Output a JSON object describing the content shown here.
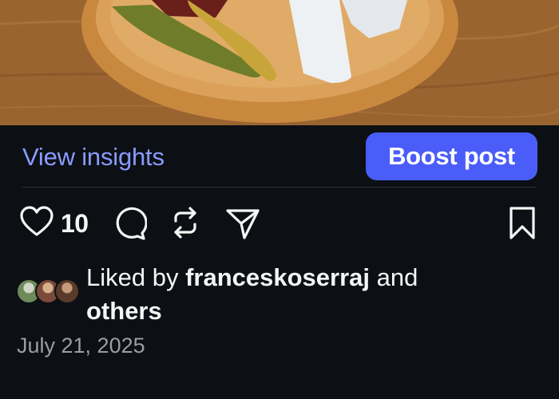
{
  "post": {
    "insights_label": "View insights",
    "boost_label": "Boost post",
    "like_count": "10",
    "liked_by_prefix": "Liked by",
    "liked_by_user": "franceskoserraj",
    "liked_by_and": "and",
    "liked_by_others": "others",
    "date": "July 21, 2025"
  },
  "icons": {
    "like": "heart-outline-icon",
    "comment": "comment-bubble-icon",
    "repost": "repost-arrows-icon",
    "share": "paper-plane-icon",
    "save": "bookmark-outline-icon"
  },
  "colors": {
    "background": "#0c1014",
    "accent_link": "#8a9bff",
    "boost_button": "#4a5df9",
    "secondary_text": "#9a9ea3"
  }
}
